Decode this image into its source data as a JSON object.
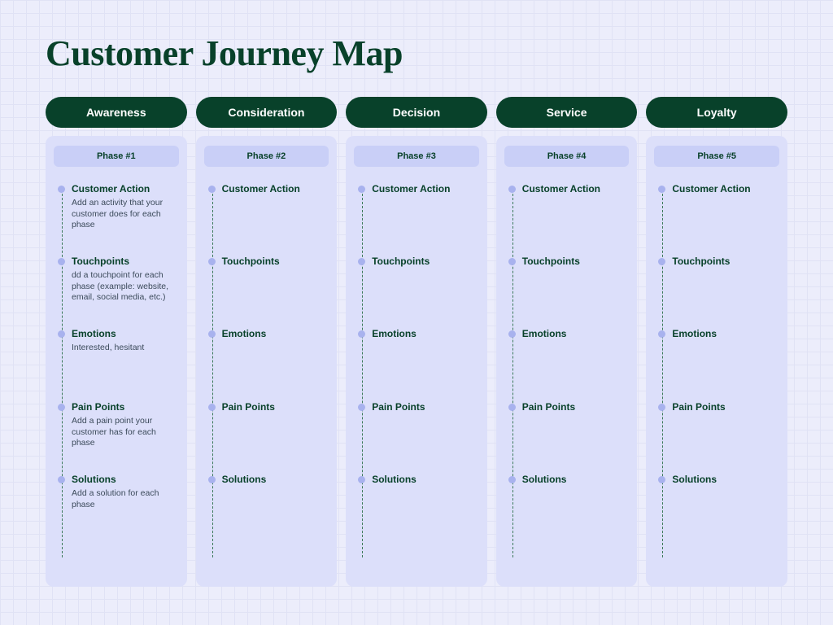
{
  "title": "Customer Journey Map",
  "stages": [
    {
      "header": "Awareness",
      "phase": "Phase #1"
    },
    {
      "header": "Consideration",
      "phase": "Phase #2"
    },
    {
      "header": "Decision",
      "phase": "Phase #3"
    },
    {
      "header": "Service",
      "phase": "Phase #4"
    },
    {
      "header": "Loyalty",
      "phase": "Phase #5"
    }
  ],
  "row_headings": [
    "Customer Action",
    "Touchpoints",
    "Emotions",
    "Pain Points",
    "Solutions"
  ],
  "descriptions": {
    "0": {
      "0": "Add an activity that your customer does for each phase",
      "1": "dd a touchpoint for each phase (example: website, email, social media, etc.)",
      "2": "Interested, hesitant",
      "3": "Add a pain point your customer has for each phase",
      "4": "Add a solution for each phase"
    }
  }
}
